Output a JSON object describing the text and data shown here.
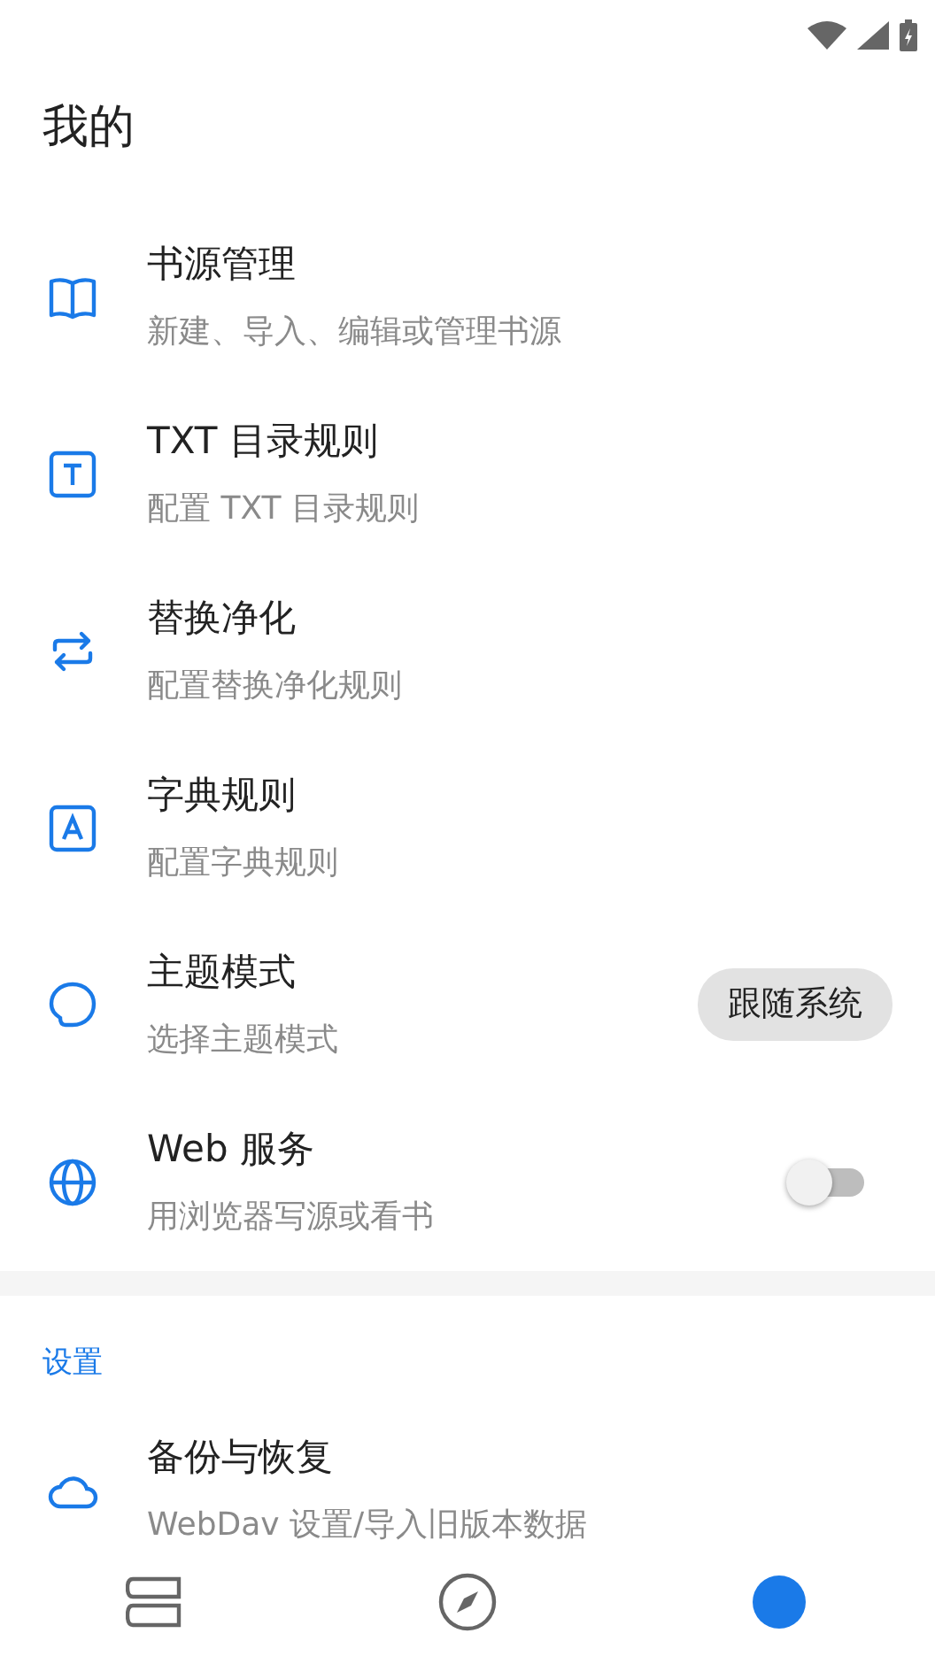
{
  "header": {
    "title": "我的"
  },
  "items": [
    {
      "title": "书源管理",
      "subtitle": "新建、导入、编辑或管理书源"
    },
    {
      "title": "TXT 目录规则",
      "subtitle": "配置 TXT 目录规则"
    },
    {
      "title": "替换净化",
      "subtitle": "配置替换净化规则"
    },
    {
      "title": "字典规则",
      "subtitle": "配置字典规则"
    },
    {
      "title": "主题模式",
      "subtitle": "选择主题模式",
      "kind": "choice",
      "value": "跟随系统"
    },
    {
      "title": "Web 服务",
      "subtitle": "用浏览器写源或看书",
      "kind": "switch",
      "on": false
    }
  ],
  "settings": {
    "heading": "设置",
    "items": [
      {
        "title": "备份与恢复",
        "subtitle": "WebDav 设置/导入旧版本数据"
      }
    ]
  },
  "bottom_nav": [
    {
      "selected": false
    },
    {
      "selected": false
    },
    {
      "selected": true
    }
  ]
}
